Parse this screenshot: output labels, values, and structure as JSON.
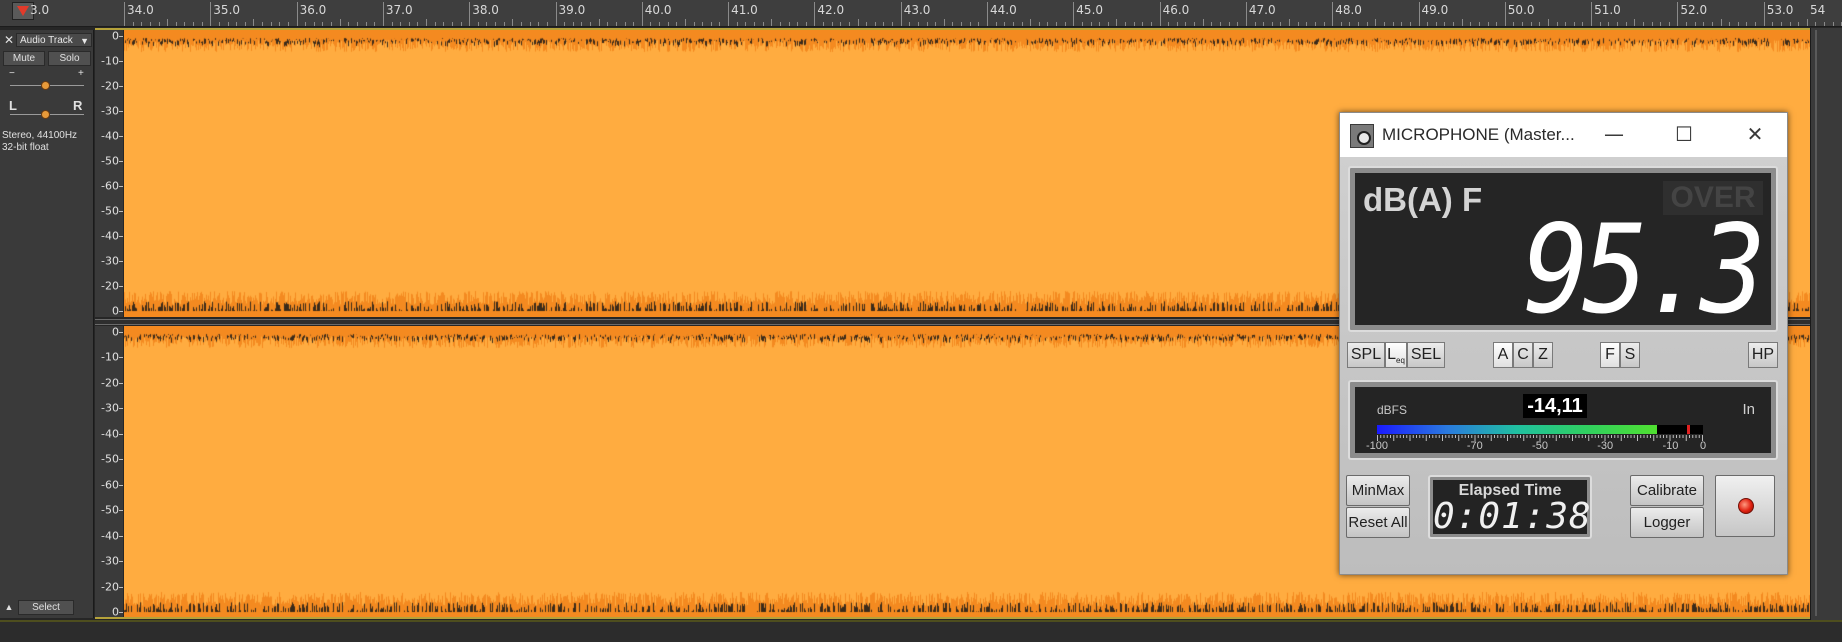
{
  "ruler": {
    "marks": [
      "34.0",
      "35.0",
      "36.0",
      "37.0",
      "38.0",
      "39.0",
      "40.0",
      "41.0",
      "42.0",
      "43.0",
      "44.0",
      "45.0",
      "46.0",
      "47.0",
      "48.0",
      "49.0",
      "50.0",
      "51.0",
      "52.0",
      "53.0"
    ],
    "left_partial": "3.0",
    "right_partial": "54"
  },
  "track": {
    "close": "✕",
    "name": "Audio Track",
    "mute": "Mute",
    "solo": "Solo",
    "gain_minus": "−",
    "gain_plus": "+",
    "pan_left": "L",
    "pan_right": "R",
    "info_line1": "Stereo, 44100Hz",
    "info_line2": "32-bit float",
    "select": "Select",
    "collapse": "▲"
  },
  "scale_labels": [
    "0",
    "-10",
    "-20",
    "-30",
    "-40",
    "-50",
    "-60",
    "-50",
    "-40",
    "-30",
    "-20",
    "0"
  ],
  "scale_labels_bottom": [
    "0",
    "-10",
    "-20",
    "-30",
    "-40",
    "-50",
    "-60",
    "-50",
    "-40",
    "-30",
    "-20",
    "0"
  ],
  "meter": {
    "title": "MICROPHONE (Master...",
    "minimize": "—",
    "maximize": "☐",
    "close": "✕",
    "weighting_label": "dB(A) F",
    "over_label": "OVER",
    "level_value": "95.3",
    "modes": {
      "spl": "SPL",
      "leq": "L",
      "leq_sub": "eq",
      "sel": "SEL",
      "a": "A",
      "c": "C",
      "z": "Z",
      "f": "F",
      "s": "S",
      "hp": "HP"
    },
    "dbfs_label": "dBFS",
    "dbfs_value": "-14,11",
    "input_label": "In",
    "dbfs_scale": [
      "-100",
      "-70",
      "-50",
      "-30",
      "-10",
      "0"
    ],
    "dbfs_level_fraction": 0.86,
    "dbfs_peak_fraction": 0.95,
    "minmax": "MinMax",
    "reset_all": "Reset All",
    "elapsed_label": "Elapsed Time",
    "elapsed_value": "0:01:38",
    "calibrate": "Calibrate",
    "logger": "Logger"
  },
  "colors": {
    "waveform_fill": "#ffac40",
    "waveform_edge": "#f48a20",
    "waveform_spike": "#3a2a1a",
    "background": "#262626"
  }
}
